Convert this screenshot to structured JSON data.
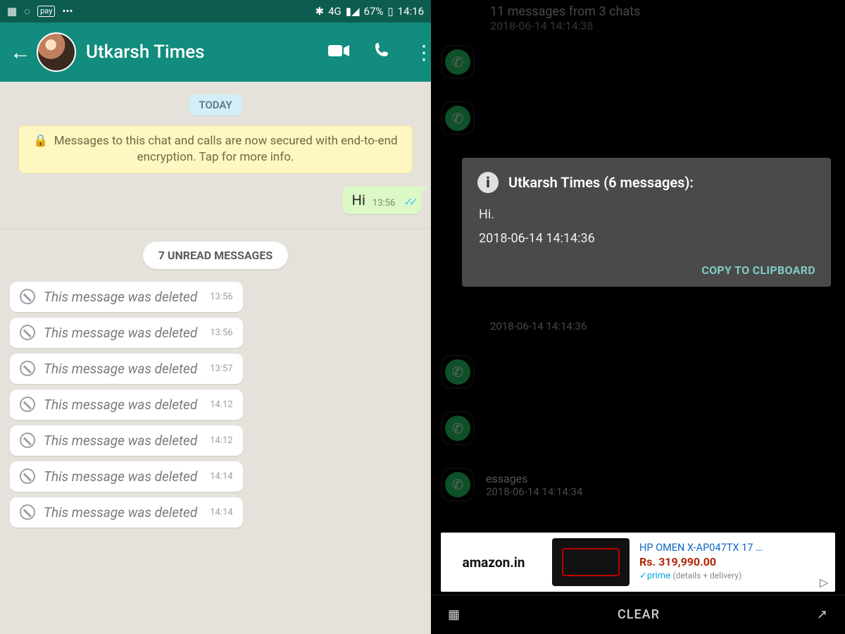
{
  "left": {
    "status": {
      "network_label": "4G",
      "battery_pct": "67%",
      "clock": "14:16"
    },
    "header": {
      "contact_name": "Utkarsh Times"
    },
    "chat": {
      "day_chip": "TODAY",
      "encryption_notice": "Messages to this chat and calls are now secured with end-to-end encryption. Tap for more info.",
      "outgoing": {
        "text": "Hi",
        "time": "13:56"
      },
      "unread_chip": "7 UNREAD MESSAGES",
      "deleted_text": "This message was deleted",
      "deleted": [
        {
          "time": "13:56"
        },
        {
          "time": "13:56"
        },
        {
          "time": "13:57"
        },
        {
          "time": "14:12"
        },
        {
          "time": "14:12"
        },
        {
          "time": "14:14"
        },
        {
          "time": "14:14"
        }
      ]
    }
  },
  "right": {
    "header": {
      "summary": "11 messages from 3 chats",
      "summary_ts": "2018-06-14 14:14:38"
    },
    "visible_ts_1": "2018-06-14 14:14:36",
    "visible_ts_2": "2018-06-14 14:14:34",
    "visible_tail": "essages",
    "dialog": {
      "title": "Utkarsh Times (6 messages):",
      "line1": "Hi.",
      "line2": "2018-06-14 14:14:36",
      "copy_label": "COPY TO CLIPBOARD"
    },
    "ad": {
      "brand": "amazon.in",
      "title": "HP OMEN X-AP047TX 17 …",
      "price": "Rs. 319,990.00",
      "prime": "✓prime",
      "fine": "(details + delivery)"
    },
    "bottombar": {
      "clear": "CLEAR"
    }
  }
}
